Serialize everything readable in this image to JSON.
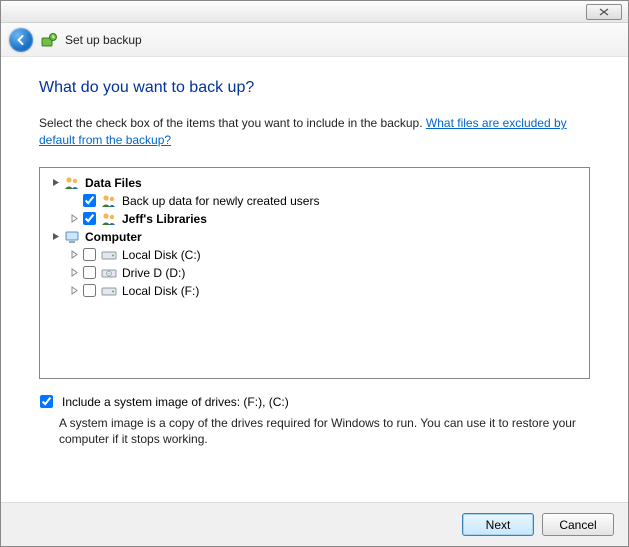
{
  "header": {
    "title": "Set up backup"
  },
  "heading": "What do you want to back up?",
  "instruction_prefix": "Select the check box of the items that you want to include in the backup. ",
  "instruction_link": "What files are excluded by default from the backup?",
  "tree": {
    "data_files": {
      "label": "Data Files",
      "new_users": "Back up data for newly created users",
      "libraries": "Jeff's Libraries"
    },
    "computer": {
      "label": "Computer",
      "drives": [
        "Local Disk (C:)",
        "Drive D (D:)",
        "Local Disk (F:)"
      ]
    }
  },
  "system_image": {
    "label": "Include a system image of drives: (F:), (C:)",
    "description": "A system image is a copy of the drives required for Windows to run. You can use it to restore your computer if it stops working."
  },
  "buttons": {
    "next": "Next",
    "cancel": "Cancel"
  }
}
